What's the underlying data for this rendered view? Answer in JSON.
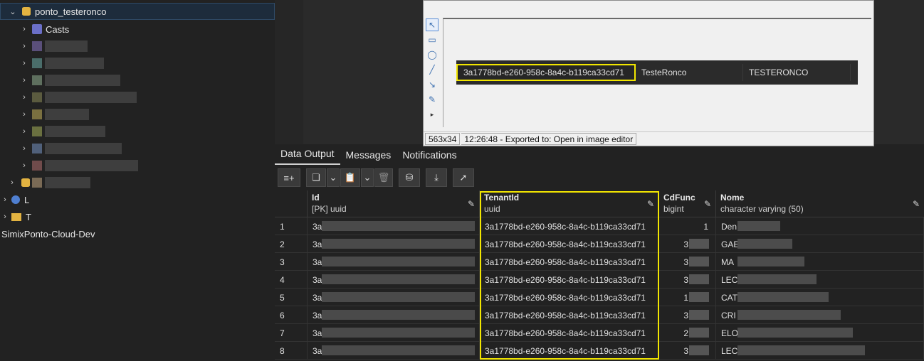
{
  "sidebar": {
    "db_name": "ponto_testeronco",
    "casts_label": "Casts",
    "l_label": "L",
    "t_label": "T",
    "server_label": "SimixPonto-Cloud-Dev"
  },
  "popup": {
    "strip": [
      "3a1778bd-e260-958c-8a4c-b119ca33cd71",
      "TesteRonco",
      "TESTERONCO"
    ],
    "status_size": "563x34",
    "status_msg": "12:26:48 - Exported to: Open in image editor"
  },
  "tabs": [
    "Data Output",
    "Messages",
    "Notifications"
  ],
  "columns": [
    {
      "name": "Id",
      "type": "[PK] uuid"
    },
    {
      "name": "TenantId",
      "type": "uuid"
    },
    {
      "name": "CdFunc",
      "type": "bigint"
    },
    {
      "name": "Nome",
      "type": "character varying (50)"
    }
  ],
  "rows": [
    {
      "num": "1",
      "id": "3a",
      "tenant": "3a1778bd-e260-958c-8a4c-b119ca33cd71",
      "cd": "1",
      "nome": "Den"
    },
    {
      "num": "2",
      "id": "3a",
      "tenant": "3a1778bd-e260-958c-8a4c-b119ca33cd71",
      "cd": "3",
      "nome": "GAE"
    },
    {
      "num": "3",
      "id": "3a",
      "tenant": "3a1778bd-e260-958c-8a4c-b119ca33cd71",
      "cd": "3",
      "nome": "MA"
    },
    {
      "num": "4",
      "id": "3a",
      "tenant": "3a1778bd-e260-958c-8a4c-b119ca33cd71",
      "cd": "3",
      "nome": "LEC"
    },
    {
      "num": "5",
      "id": "3a",
      "tenant": "3a1778bd-e260-958c-8a4c-b119ca33cd71",
      "cd": "1",
      "nome": "CAT"
    },
    {
      "num": "6",
      "id": "3a",
      "tenant": "3a1778bd-e260-958c-8a4c-b119ca33cd71",
      "cd": "3",
      "nome": "CRI"
    },
    {
      "num": "7",
      "id": "3a",
      "tenant": "3a1778bd-e260-958c-8a4c-b119ca33cd71",
      "cd": "2",
      "nome": "ELO"
    },
    {
      "num": "8",
      "id": "3a",
      "tenant": "3a1778bd-e260-958c-8a4c-b119ca33cd71",
      "cd": "3",
      "nome": "LEC"
    }
  ],
  "colors": {
    "highlight": "#f2e600",
    "db_icon": "#e3b341"
  }
}
